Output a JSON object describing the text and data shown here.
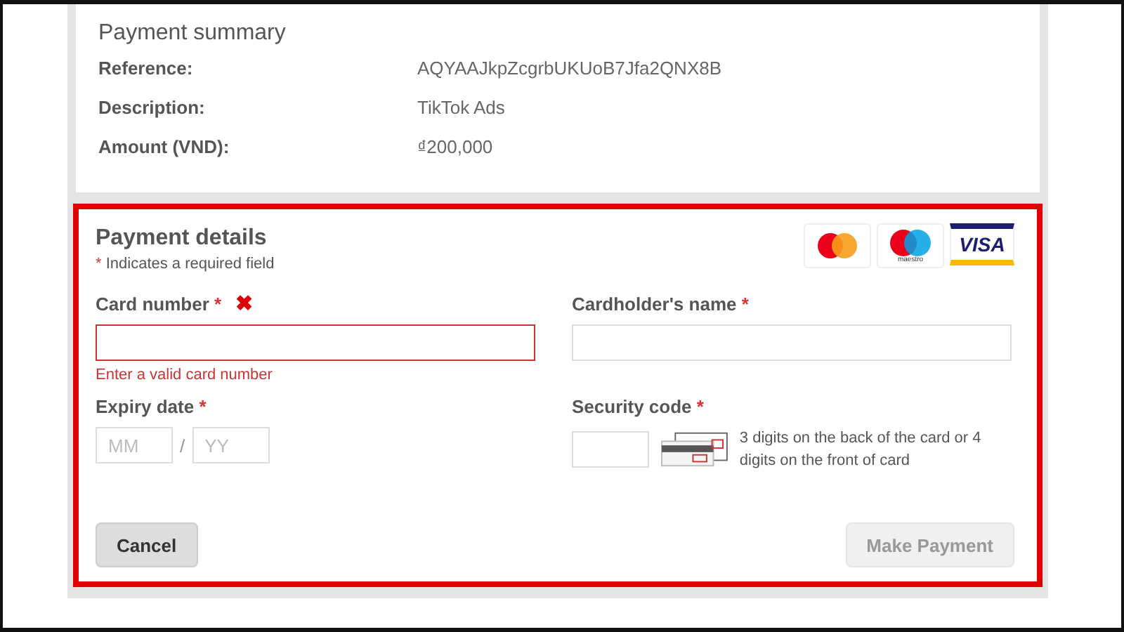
{
  "summary": {
    "heading": "Payment summary",
    "rows": [
      {
        "label": "Reference:",
        "value": "AQYAAJkpZcgrbUKUoB7Jfa2QNX8B"
      },
      {
        "label": "Description:",
        "value": "TikTok Ads"
      },
      {
        "label": "Amount (VND):",
        "value": "₫200,000"
      }
    ]
  },
  "payment": {
    "title": "Payment details",
    "required_mark": "*",
    "required_note": "Indicates a required field",
    "cards": [
      {
        "kind": "mastercard"
      },
      {
        "kind": "maestro",
        "caption": "maestro"
      },
      {
        "kind": "visa",
        "label": "VISA"
      }
    ],
    "card_number": {
      "label": "Card number",
      "required": true,
      "invalid": true,
      "error_icon": "✖",
      "error": "Enter a valid card number"
    },
    "cardholder_name": {
      "label": "Cardholder's name",
      "required": true,
      "invalid": false
    },
    "expiry": {
      "label": "Expiry date",
      "required": true,
      "month_placeholder": "MM",
      "separator": "/",
      "year_placeholder": "YY"
    },
    "security_code": {
      "label": "Security code",
      "required": true,
      "hint": "3 digits on the back of the card or 4 digits on the front of card"
    },
    "buttons": [
      {
        "label": "Cancel",
        "disabled": false
      },
      {
        "label": "Make Payment",
        "disabled": true
      }
    ]
  }
}
